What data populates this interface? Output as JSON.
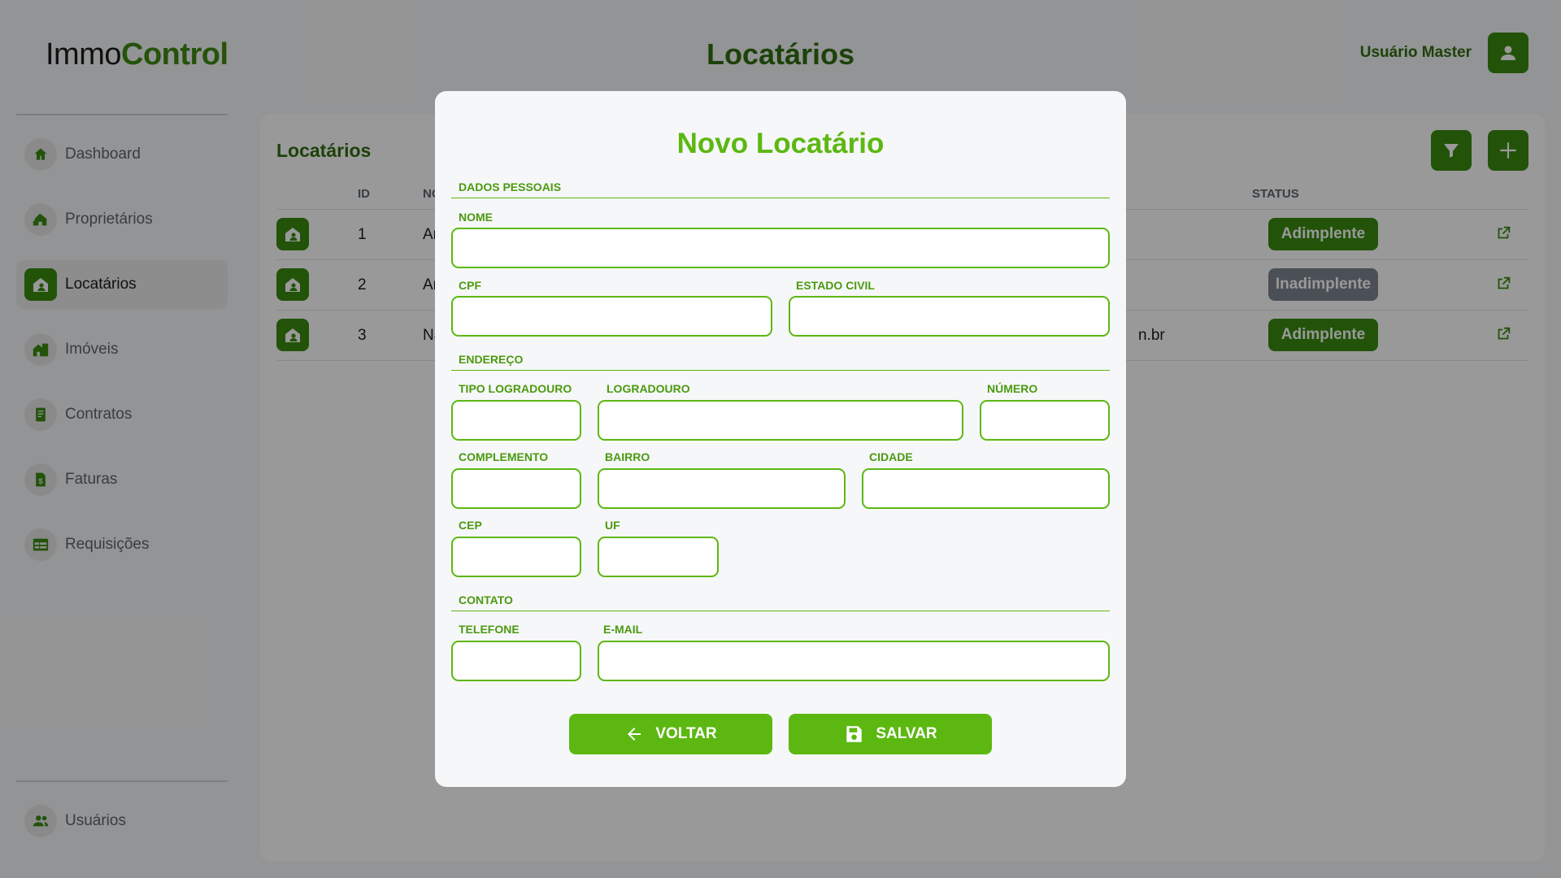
{
  "brand": {
    "part1": "Immo",
    "part2": "Control"
  },
  "header": {
    "title": "Locatários",
    "user_name": "Usuário Master"
  },
  "sidebar": {
    "items": [
      {
        "label": "Dashboard",
        "icon": "home-icon"
      },
      {
        "label": "Proprietários",
        "icon": "owner-icon"
      },
      {
        "label": "Locatários",
        "icon": "tenant-icon",
        "active": true
      },
      {
        "label": "Imóveis",
        "icon": "building-icon"
      },
      {
        "label": "Contratos",
        "icon": "contract-icon"
      },
      {
        "label": "Faturas",
        "icon": "invoice-icon"
      },
      {
        "label": "Requisições",
        "icon": "requests-icon"
      }
    ],
    "footer_item": {
      "label": "Usuários",
      "icon": "users-icon"
    }
  },
  "content": {
    "title": "Locatários",
    "columns": {
      "id": "ID",
      "name": "NO",
      "status": "STATUS"
    },
    "rows": [
      {
        "id": "1",
        "name": "Ar",
        "extra": "",
        "status": "Adimplente"
      },
      {
        "id": "2",
        "name": "Ar",
        "extra": "",
        "status": "Inadimplente"
      },
      {
        "id": "3",
        "name": "Na",
        "extra": "n.br",
        "status": "Adimplente"
      }
    ]
  },
  "modal": {
    "title": "Novo Locatário",
    "sections": {
      "personal": "DADOS PESSOAIS",
      "address": "ENDEREÇO",
      "contact": "CONTATO"
    },
    "labels": {
      "nome": "NOME",
      "cpf": "CPF",
      "estado_civil": "ESTADO CIVIL",
      "tipo_logradouro": "TIPO LOGRADOURO",
      "logradouro": "LOGRADOURO",
      "numero": "NÚMERO",
      "complemento": "COMPLEMENTO",
      "bairro": "BAIRRO",
      "cidade": "CIDADE",
      "cep": "CEP",
      "uf": "UF",
      "telefone": "TELEFONE",
      "email": "E-MAIL"
    },
    "values": {
      "nome": "",
      "cpf": "",
      "estado_civil": "",
      "tipo_logradouro": "",
      "logradouro": "",
      "numero": "",
      "complemento": "",
      "bairro": "",
      "cidade": "",
      "cep": "",
      "uf": "",
      "telefone": "",
      "email": ""
    },
    "buttons": {
      "back": "VOLTAR",
      "save": "SALVAR"
    }
  },
  "colors": {
    "primary": "#3a8a10",
    "accent": "#5cb811",
    "inactive_status": "#7d8590"
  }
}
